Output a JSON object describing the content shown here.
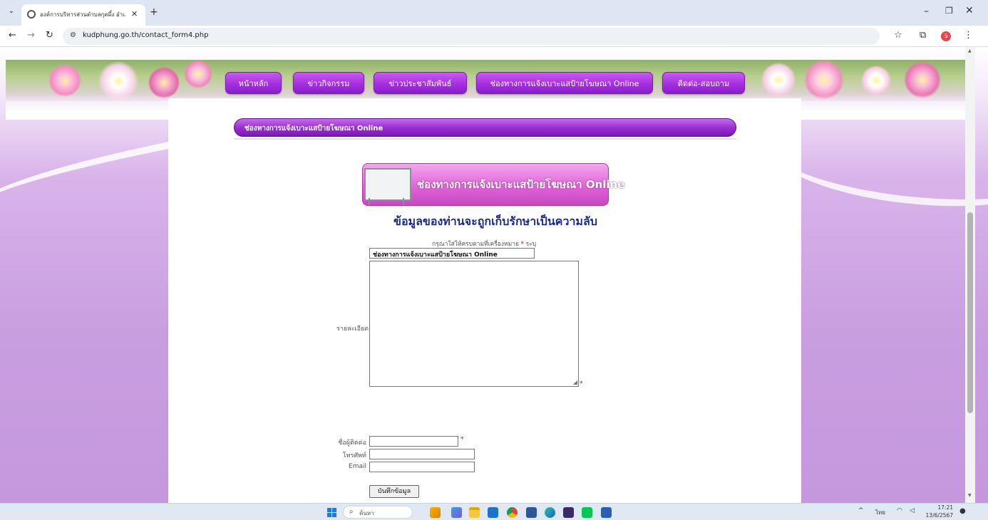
{
  "browser": {
    "tab_title": "องค์การบริหารส่วนตำบลกุดผึ้ง อำเภอ",
    "url": "kudphung.go.th/contact_form4.php",
    "profile_initial": "S"
  },
  "nav": {
    "items": [
      {
        "label": "หน้าหลัก"
      },
      {
        "label": "ข่าวกิจกรรม"
      },
      {
        "label": "ข่าวประชาสัมพันธ์"
      },
      {
        "label": "ช่องทางการแจ้งเบาะแสป้ายโฆษณา Online"
      },
      {
        "label": "ติดต่อ-สอบถาม"
      }
    ]
  },
  "section": {
    "title": "ช่องทางการแจ้งเบาะแสป้ายโฆษณา Online"
  },
  "promo": {
    "text": "ช่องทางการแจ้งเบาะแสป้ายโฆษณา Online"
  },
  "form": {
    "privacy_notice": "ข้อมูลของท่านจะถูกเก็บรักษาเป็นความลับ",
    "hint_prefix": "กรุณาใส่ให้ครบตามที่เครื่องหมาย",
    "hint_suffix": "ระบุ",
    "required_mark": "*",
    "subject_value": "ช่องทางการแจ้งเบาะแสป้ายโฆษณา Online",
    "detail_label": "รายละเอียด",
    "contact_name_label": "ชื่อผู้ติดต่อ",
    "phone_label": "โทรศัพท์",
    "email_label": "Email",
    "submit_label": "บันทึกข้อมูล"
  },
  "taskbar": {
    "search_placeholder": "ค้นหา",
    "language": "ไทย",
    "time": "17:21",
    "date": "13/6/2567",
    "apps": [
      "news-weather",
      "paint",
      "file-explorer",
      "mail",
      "chrome",
      "store",
      "edge",
      "terminal",
      "line",
      "word"
    ]
  },
  "colors": {
    "nav_purple": "#a52fe0",
    "section_purple": "#9b30d3",
    "promo_pink": "#de5fd6",
    "privacy_blue": "#1a2a8a",
    "required_red": "#dd0000"
  }
}
